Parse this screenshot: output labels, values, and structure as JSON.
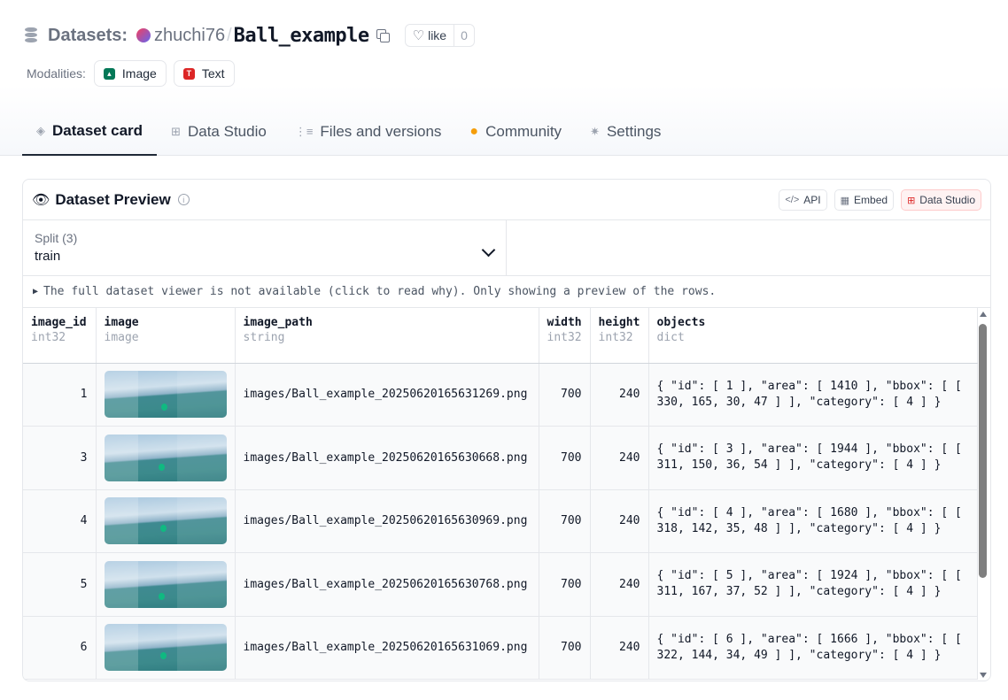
{
  "header": {
    "datasets_label": "Datasets:",
    "owner": "zhuchi76",
    "separator": "/",
    "repo_name": "Ball_example",
    "like_label": "like",
    "like_count": "0",
    "modalities_label": "Modalities:",
    "modalities": [
      {
        "label": "Image",
        "icon": "image-icon"
      },
      {
        "label": "Text",
        "icon": "text-icon"
      }
    ]
  },
  "tabs": [
    {
      "label": "Dataset card",
      "icon": "cube-icon",
      "active": true
    },
    {
      "label": "Data Studio",
      "icon": "table-icon",
      "active": false
    },
    {
      "label": "Files and versions",
      "icon": "files-icon",
      "active": false
    },
    {
      "label": "Community",
      "icon": "hugging-face-icon",
      "active": false
    },
    {
      "label": "Settings",
      "icon": "gear-icon",
      "active": false
    }
  ],
  "preview": {
    "title": "Dataset Preview",
    "buttons": {
      "api": "API",
      "embed": "Embed",
      "data_studio": "Data Studio"
    },
    "split_label": "Split (3)",
    "split_value": "train",
    "notice": "The full dataset viewer is not available (click to read why). Only showing a preview of the rows."
  },
  "table": {
    "columns": [
      {
        "name": "image_id",
        "type": "int32"
      },
      {
        "name": "image",
        "type": "image"
      },
      {
        "name": "image_path",
        "type": "string"
      },
      {
        "name": "width",
        "type": "int32"
      },
      {
        "name": "height",
        "type": "int32"
      },
      {
        "name": "objects",
        "type": "dict"
      }
    ],
    "rows": [
      {
        "image_id": "1",
        "image_path": "images/Ball_example_20250620165631269.png",
        "width": "700",
        "height": "240",
        "objects": "{ \"id\": [ 1 ], \"area\": [ 1410 ], \"bbox\": [ [ 330, 165, 30, 47 ] ], \"category\": [ 4 ] }"
      },
      {
        "image_id": "3",
        "image_path": "images/Ball_example_20250620165630668.png",
        "width": "700",
        "height": "240",
        "objects": "{ \"id\": [ 3 ], \"area\": [ 1944 ], \"bbox\": [ [ 311, 150, 36, 54 ] ], \"category\": [ 4 ] }"
      },
      {
        "image_id": "4",
        "image_path": "images/Ball_example_20250620165630969.png",
        "width": "700",
        "height": "240",
        "objects": "{ \"id\": [ 4 ], \"area\": [ 1680 ], \"bbox\": [ [ 318, 142, 35, 48 ] ], \"category\": [ 4 ] }"
      },
      {
        "image_id": "5",
        "image_path": "images/Ball_example_20250620165630768.png",
        "width": "700",
        "height": "240",
        "objects": "{ \"id\": [ 5 ], \"area\": [ 1924 ], \"bbox\": [ [ 311, 167, 37, 52 ] ], \"category\": [ 4 ] }"
      },
      {
        "image_id": "6",
        "image_path": "images/Ball_example_20250620165631069.png",
        "width": "700",
        "height": "240",
        "objects": "{ \"id\": [ 6 ], \"area\": [ 1666 ], \"bbox\": [ [ 322, 144, 34, 49 ] ], \"category\": [ 4 ] }"
      }
    ]
  }
}
